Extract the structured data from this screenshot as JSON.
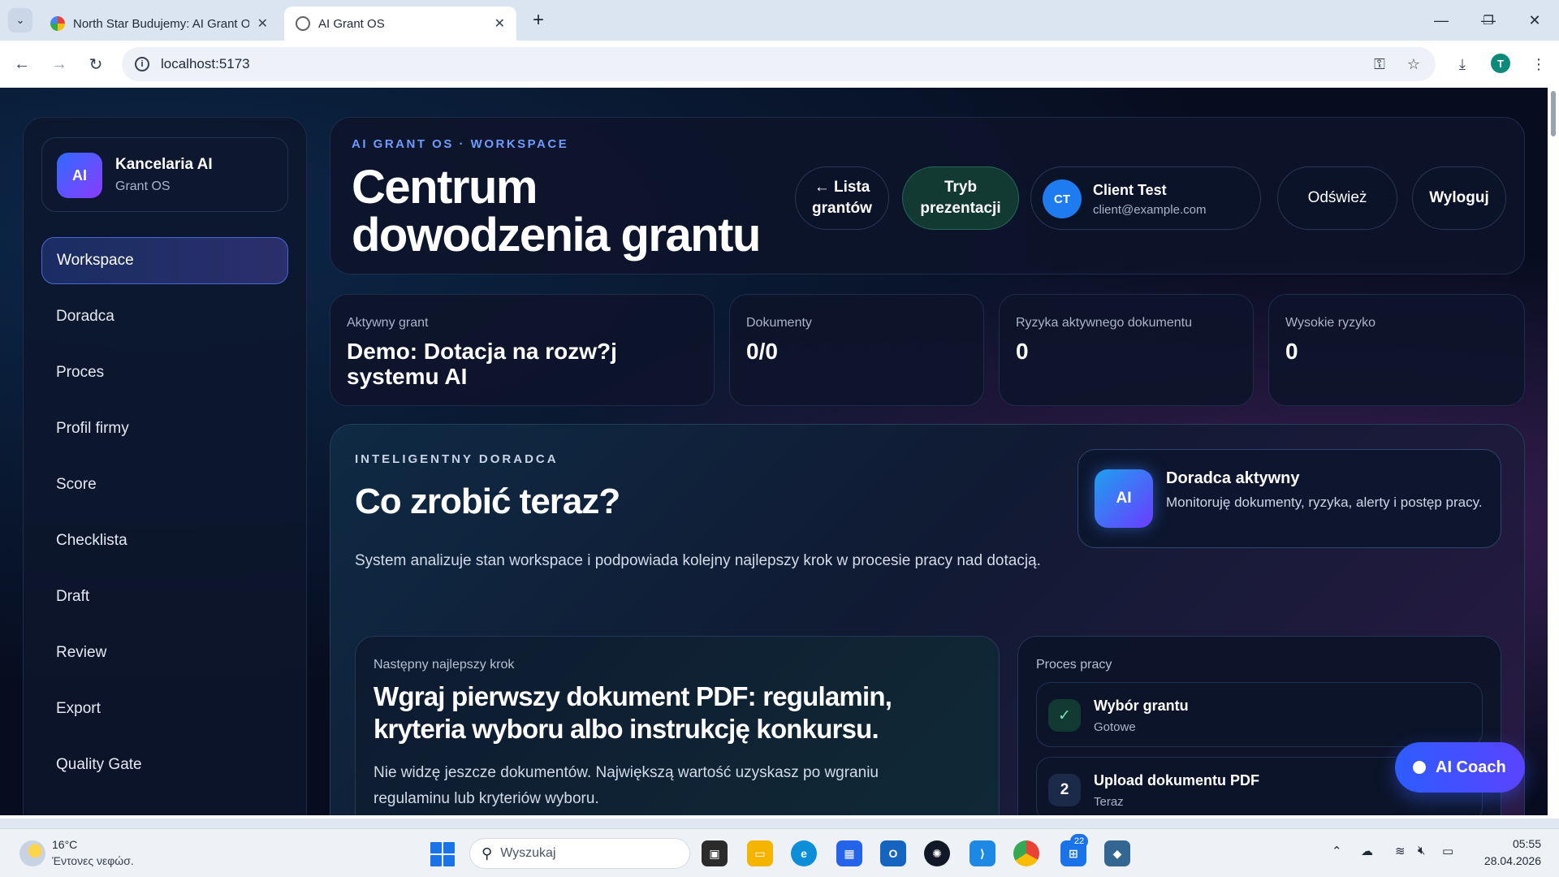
{
  "browser": {
    "tabs": [
      {
        "title": "North Star Budujemy: AI Grant OS",
        "icon": "google-favicon"
      },
      {
        "title": "AI Grant OS",
        "icon": "globe-favicon"
      }
    ],
    "address": "localhost:5173",
    "profile_initial": "T"
  },
  "sidebar": {
    "brand_logo": "AI",
    "brand_name": "Kancelaria AI",
    "brand_sub": "Grant OS",
    "items": [
      {
        "label": "Workspace",
        "active": true
      },
      {
        "label": "Doradca"
      },
      {
        "label": "Proces"
      },
      {
        "label": "Profil firmy"
      },
      {
        "label": "Score"
      },
      {
        "label": "Checklista"
      },
      {
        "label": "Draft"
      },
      {
        "label": "Review"
      },
      {
        "label": "Export"
      },
      {
        "label": "Quality Gate"
      }
    ]
  },
  "header": {
    "eyebrow": "AI GRANT OS · WORKSPACE",
    "title": "Centrum dowodzenia grantu",
    "grants_list_button": "← Lista grantów",
    "presentation_button": "Tryb prezentacji",
    "user_initials": "CT",
    "user_name": "Client Test",
    "user_email": "client@example.com",
    "refresh_button": "Odśwież",
    "logout_button": "Wyloguj"
  },
  "stats": [
    {
      "label": "Aktywny grant",
      "value": "Demo: Dotacja na rozw?j systemu AI"
    },
    {
      "label": "Dokumenty",
      "value": "0/0"
    },
    {
      "label": "Ryzyka aktywnego dokumentu",
      "value": "0"
    },
    {
      "label": "Wysokie ryzyko",
      "value": "0"
    }
  ],
  "advisor": {
    "eyebrow": "INTELIGENTNY DORADCA",
    "title": "Co zrobić teraz?",
    "description": "System analizuje stan workspace i podpowiada kolejny najlepszy krok w procesie pracy nad dotacją.",
    "badge_icon": "AI",
    "badge_title": "Doradca aktywny",
    "badge_desc": "Monitoruję dokumenty, ryzyka, alerty i postęp pracy.",
    "next_label": "Następny najlepszy krok",
    "next_title": "Wgraj pierwszy dokument PDF: regulamin, kryteria wyboru albo instrukcję konkursu.",
    "next_desc": "Nie widzę jeszcze dokumentów. Największą wartość uzyskasz po wgraniu regulaminu lub kryteriów wyboru.",
    "process_label": "Proces pracy",
    "steps": [
      {
        "marker": "✓",
        "title": "Wybór grantu",
        "status": "Gotowe"
      },
      {
        "marker": "2",
        "title": "Upload dokumentu PDF",
        "status": "Teraz"
      }
    ]
  },
  "coach_button": "AI Coach",
  "taskbar": {
    "temperature": "16°C",
    "weather": "Έντονες νεφώσ.",
    "search_placeholder": "Wyszukaj",
    "badge_count": "22",
    "time": "05:55",
    "date": "28.04.2026"
  }
}
